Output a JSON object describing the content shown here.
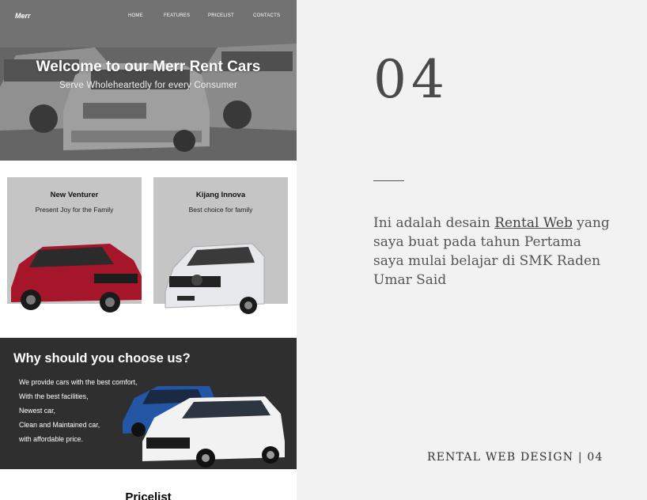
{
  "site": {
    "logo": "Merr",
    "nav": [
      "HOME",
      "FEATURES",
      "PRICELIST",
      "CONTACTS"
    ],
    "hero_title": "Welcome to our Merr Rent Cars",
    "hero_subtitle": "Serve Wholeheartedly for every Consumer",
    "cards": [
      {
        "title": "New Venturer",
        "subtitle": "Present Joy for the Family",
        "car_color": "#a5162a"
      },
      {
        "title": "Kijang Innova",
        "subtitle": "Best choice for family",
        "car_color": "#e6e8ec"
      }
    ],
    "why": {
      "title": "Why should you choose us?",
      "lines": [
        "We provide cars with the best comfort,",
        "With the best facilities,",
        "Newest car,",
        "Clean and Maintained car,",
        "with affordable price."
      ]
    },
    "pricelist_heading": "Pricelist"
  },
  "panel": {
    "number": "04",
    "description_before": "Ini adalah desain ",
    "description_link": "Rental Web",
    "description_after": " yang saya buat pada tahun Pertama saya mulai belajar di SMK Raden Umar Said",
    "footer": "RENTAL WEB DESIGN | 04"
  },
  "colors": {
    "background": "#f2f2f2",
    "dark_section": "#2f2f2f",
    "card_gray": "#c5c5c5"
  }
}
